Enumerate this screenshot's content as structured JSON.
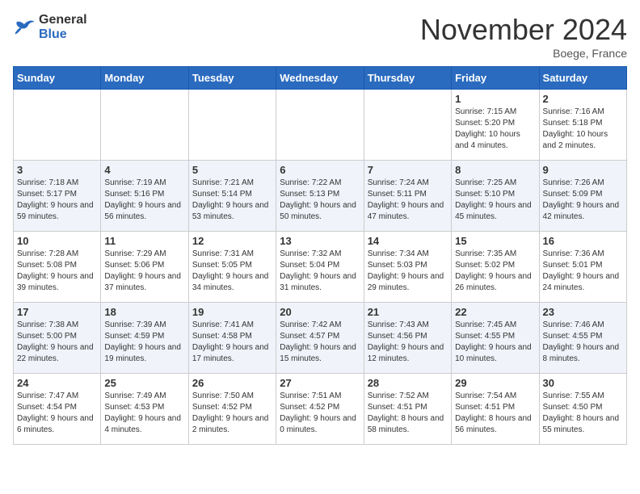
{
  "header": {
    "logo_general": "General",
    "logo_blue": "Blue",
    "month_title": "November 2024",
    "location": "Boege, France"
  },
  "weekdays": [
    "Sunday",
    "Monday",
    "Tuesday",
    "Wednesday",
    "Thursday",
    "Friday",
    "Saturday"
  ],
  "weeks": [
    [
      null,
      null,
      null,
      null,
      null,
      {
        "day": 1,
        "sunrise": "7:15 AM",
        "sunset": "5:20 PM",
        "daylight": "10 hours and 4 minutes."
      },
      {
        "day": 2,
        "sunrise": "7:16 AM",
        "sunset": "5:18 PM",
        "daylight": "10 hours and 2 minutes."
      }
    ],
    [
      {
        "day": 3,
        "sunrise": "7:18 AM",
        "sunset": "5:17 PM",
        "daylight": "9 hours and 59 minutes."
      },
      {
        "day": 4,
        "sunrise": "7:19 AM",
        "sunset": "5:16 PM",
        "daylight": "9 hours and 56 minutes."
      },
      {
        "day": 5,
        "sunrise": "7:21 AM",
        "sunset": "5:14 PM",
        "daylight": "9 hours and 53 minutes."
      },
      {
        "day": 6,
        "sunrise": "7:22 AM",
        "sunset": "5:13 PM",
        "daylight": "9 hours and 50 minutes."
      },
      {
        "day": 7,
        "sunrise": "7:24 AM",
        "sunset": "5:11 PM",
        "daylight": "9 hours and 47 minutes."
      },
      {
        "day": 8,
        "sunrise": "7:25 AM",
        "sunset": "5:10 PM",
        "daylight": "9 hours and 45 minutes."
      },
      {
        "day": 9,
        "sunrise": "7:26 AM",
        "sunset": "5:09 PM",
        "daylight": "9 hours and 42 minutes."
      }
    ],
    [
      {
        "day": 10,
        "sunrise": "7:28 AM",
        "sunset": "5:08 PM",
        "daylight": "9 hours and 39 minutes."
      },
      {
        "day": 11,
        "sunrise": "7:29 AM",
        "sunset": "5:06 PM",
        "daylight": "9 hours and 37 minutes."
      },
      {
        "day": 12,
        "sunrise": "7:31 AM",
        "sunset": "5:05 PM",
        "daylight": "9 hours and 34 minutes."
      },
      {
        "day": 13,
        "sunrise": "7:32 AM",
        "sunset": "5:04 PM",
        "daylight": "9 hours and 31 minutes."
      },
      {
        "day": 14,
        "sunrise": "7:34 AM",
        "sunset": "5:03 PM",
        "daylight": "9 hours and 29 minutes."
      },
      {
        "day": 15,
        "sunrise": "7:35 AM",
        "sunset": "5:02 PM",
        "daylight": "9 hours and 26 minutes."
      },
      {
        "day": 16,
        "sunrise": "7:36 AM",
        "sunset": "5:01 PM",
        "daylight": "9 hours and 24 minutes."
      }
    ],
    [
      {
        "day": 17,
        "sunrise": "7:38 AM",
        "sunset": "5:00 PM",
        "daylight": "9 hours and 22 minutes."
      },
      {
        "day": 18,
        "sunrise": "7:39 AM",
        "sunset": "4:59 PM",
        "daylight": "9 hours and 19 minutes."
      },
      {
        "day": 19,
        "sunrise": "7:41 AM",
        "sunset": "4:58 PM",
        "daylight": "9 hours and 17 minutes."
      },
      {
        "day": 20,
        "sunrise": "7:42 AM",
        "sunset": "4:57 PM",
        "daylight": "9 hours and 15 minutes."
      },
      {
        "day": 21,
        "sunrise": "7:43 AM",
        "sunset": "4:56 PM",
        "daylight": "9 hours and 12 minutes."
      },
      {
        "day": 22,
        "sunrise": "7:45 AM",
        "sunset": "4:55 PM",
        "daylight": "9 hours and 10 minutes."
      },
      {
        "day": 23,
        "sunrise": "7:46 AM",
        "sunset": "4:55 PM",
        "daylight": "9 hours and 8 minutes."
      }
    ],
    [
      {
        "day": 24,
        "sunrise": "7:47 AM",
        "sunset": "4:54 PM",
        "daylight": "9 hours and 6 minutes."
      },
      {
        "day": 25,
        "sunrise": "7:49 AM",
        "sunset": "4:53 PM",
        "daylight": "9 hours and 4 minutes."
      },
      {
        "day": 26,
        "sunrise": "7:50 AM",
        "sunset": "4:52 PM",
        "daylight": "9 hours and 2 minutes."
      },
      {
        "day": 27,
        "sunrise": "7:51 AM",
        "sunset": "4:52 PM",
        "daylight": "9 hours and 0 minutes."
      },
      {
        "day": 28,
        "sunrise": "7:52 AM",
        "sunset": "4:51 PM",
        "daylight": "8 hours and 58 minutes."
      },
      {
        "day": 29,
        "sunrise": "7:54 AM",
        "sunset": "4:51 PM",
        "daylight": "8 hours and 56 minutes."
      },
      {
        "day": 30,
        "sunrise": "7:55 AM",
        "sunset": "4:50 PM",
        "daylight": "8 hours and 55 minutes."
      }
    ]
  ],
  "labels": {
    "sunrise": "Sunrise:",
    "sunset": "Sunset:",
    "daylight": "Daylight:"
  }
}
